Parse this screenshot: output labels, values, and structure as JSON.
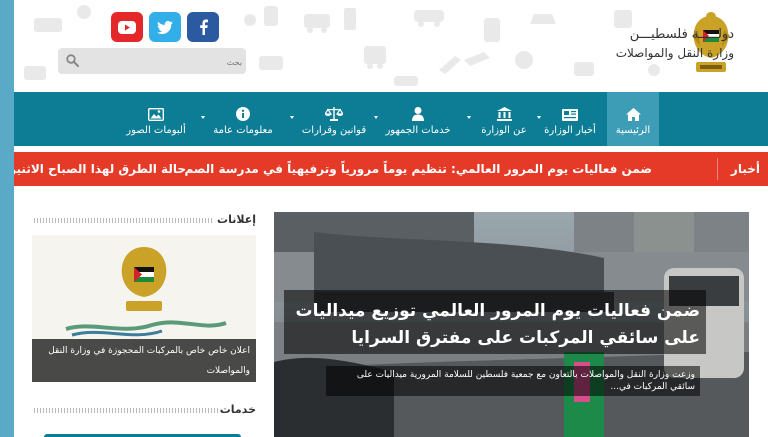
{
  "header": {
    "brand_line1": "دولـــــة فلسطيـــن",
    "brand_line2": "وزارة النقل والمواصلات",
    "search": {
      "placeholder": "بحث",
      "value": ""
    },
    "social": [
      "youtube-icon",
      "twitter-icon",
      "facebook-icon"
    ]
  },
  "nav": {
    "items": [
      {
        "label": "الرئيسية",
        "icon": "home-icon"
      },
      {
        "label": "أخبار الوزارة",
        "icon": "newspaper-icon"
      },
      {
        "label": "عن الوزارة",
        "icon": "bank-icon"
      },
      {
        "label": "خدمات الجمهور",
        "icon": "user-icon"
      },
      {
        "label": "قوانين وقرارات",
        "icon": "scales-icon"
      },
      {
        "label": "معلومات عامة",
        "icon": "info-icon"
      },
      {
        "label": "ألبومات الصور",
        "icon": "image-icon"
      }
    ]
  },
  "ticker": {
    "label": "أخبار",
    "items": [
      "ضمن فعاليات يوم المرور العالمي: تنظيم يوماً مرورياً وترفيهياً في مدرسة الصم",
      "حالة الطرق لهذا الصباح الاثنين"
    ]
  },
  "featured": {
    "title": "ضمن فعاليات يوم المرور العالمي توزيع ميداليات على سائقي المركبات على مفترق السرايا",
    "summary": "وزعت وزارة النقل والمواصلات بالتعاون مع جمعية فلسطين للسلامة المرورية ميداليات على سائقي المركبات في..."
  },
  "sidebar": {
    "ads_title": "إعلانات",
    "ad_caption": "اعلان خاص خاص بالمركبات المحجوزة في وزارة النقل والمواصلات",
    "services_title": "خدمات"
  },
  "colors": {
    "nav": "#0d7d95",
    "nav_active": "#3e9db6",
    "ticker": "#e53a27",
    "background": "#5aa9c6"
  }
}
